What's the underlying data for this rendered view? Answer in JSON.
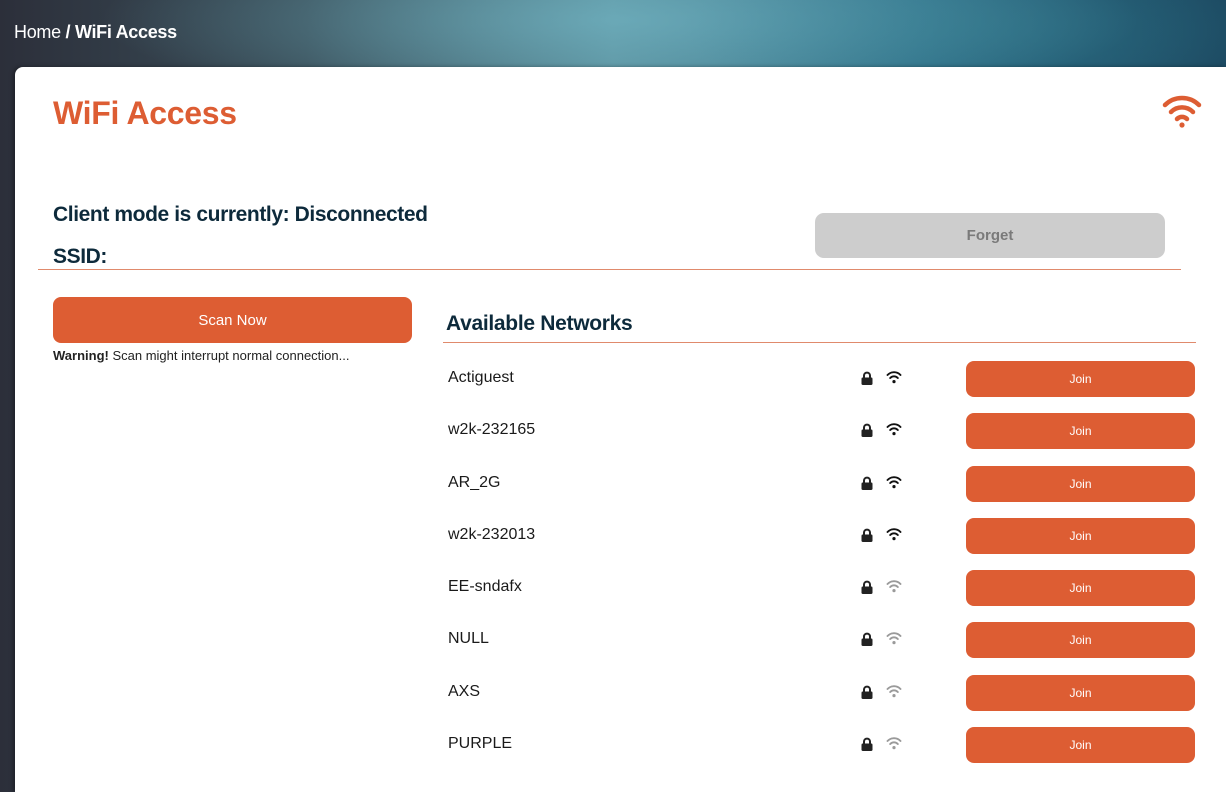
{
  "breadcrumb": {
    "home": "Home",
    "separator": "/",
    "current": "WiFi Access"
  },
  "page": {
    "title": "WiFi Access",
    "header_icon": "wifi-icon"
  },
  "status": {
    "client_mode_label": "Client mode is currently: Disconnected",
    "ssid_label": "SSID:"
  },
  "actions": {
    "forget_label": "Forget",
    "scan_label": "Scan Now"
  },
  "warning": {
    "strong": "Warning!",
    "text": " Scan might interrupt normal connection..."
  },
  "networks": {
    "title": "Available Networks",
    "join_label": "Join",
    "items": [
      {
        "ssid": "Actiguest",
        "secured": true,
        "signal": "strong"
      },
      {
        "ssid": "w2k-232165",
        "secured": true,
        "signal": "strong"
      },
      {
        "ssid": "AR_2G",
        "secured": true,
        "signal": "strong"
      },
      {
        "ssid": "w2k-232013",
        "secured": true,
        "signal": "strong"
      },
      {
        "ssid": "EE-sndafx",
        "secured": true,
        "signal": "weak"
      },
      {
        "ssid": "NULL",
        "secured": true,
        "signal": "weak"
      },
      {
        "ssid": "AXS",
        "secured": true,
        "signal": "weak"
      },
      {
        "ssid": "PURPLE",
        "secured": true,
        "signal": "weak"
      }
    ]
  },
  "colors": {
    "accent": "#dd5d33",
    "heading": "#0d2a3b",
    "disabled_button": "#cdcdcd",
    "signal_strong": "#111111",
    "signal_weak": "#9a9a9a"
  }
}
